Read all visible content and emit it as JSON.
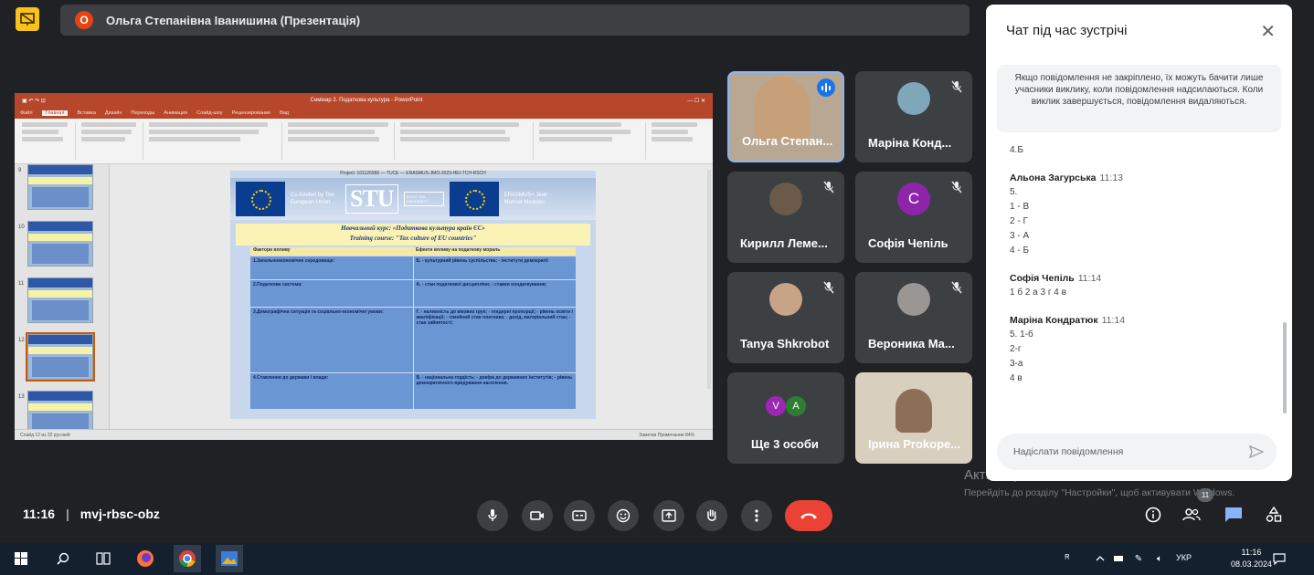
{
  "banner": {
    "avatar_letter": "О",
    "presenter": "Ольга Степанівна Іванишина (Презентація)"
  },
  "presentation": {
    "window_title": "Семінар 2. Податкова культура - PowerPoint",
    "menu": [
      "Файл",
      "Главная",
      "Вставка",
      "Дизайн",
      "Переходы",
      "Анимация",
      "Слайд-шоу",
      "Рецензирование",
      "Вид"
    ],
    "slide_numbers": [
      "9",
      "10",
      "11",
      "12",
      "13"
    ],
    "slide": {
      "header": "Project: 101126966 — TUCE — ERASMUS-JMO-2023-HEI-TCH-RSCH",
      "cofunded": "Co-funded by The European Union",
      "stu": "STU",
      "stu_sub": "STATE TAX UNIVERSITY",
      "jean_monnet": "ERASMUS+ Jean Monnet Modules",
      "course_ua": "Навчальний курс: «Податкова культура країн ЄС»",
      "course_en": "Training course: \"Tax culture of EU countries\"",
      "table_head": [
        "Фактори впливу",
        "Ефекти впливу на податкову мораль"
      ],
      "rows": [
        [
          "1.Загальноекономічне середовище:",
          "Б. - культурний рівень суспільства; - інститути демократії"
        ],
        [
          "2.Податкова система:",
          "А. - стан податкової дисципліни; - ставки оподаткування;"
        ],
        [
          "3.Демографічна ситуація та соціально-економічні умови:",
          "Г. - належність до вікових груп; - гендерні пропорції; - рівень освіти і кваліфікації; - сімейний стан платника; - дохід, матеріальний стан; - стан зайнятості;"
        ],
        [
          "4.Ставлення до держави і влади:",
          "В. - національна гордість; - довіра до державних інститутів; - рівень демократичного врядування населення."
        ]
      ]
    },
    "status_left": "Слайд 12 из 32   русский",
    "status_right": "Заметки   Примечания   84%"
  },
  "tiles": [
    {
      "name": "Ольга Степан...",
      "kind": "video-speaking"
    },
    {
      "name": "Маріна Конд...",
      "kind": "photo"
    },
    {
      "name": "Кирилл Леме...",
      "kind": "photo"
    },
    {
      "name": "Софія Чепіль",
      "kind": "letter",
      "letter": "С"
    },
    {
      "name": "Tanya Shkrobot",
      "kind": "photo"
    },
    {
      "name": "Вероника Ма...",
      "kind": "photo"
    },
    {
      "name": "Ще 3 особи",
      "kind": "more",
      "letters": [
        "V",
        "A"
      ]
    },
    {
      "name": "Ірина Prokope...",
      "kind": "video"
    }
  ],
  "chat": {
    "title": "Чат під час зустрічі",
    "note": "Якщо повідомлення не закріплено, їх можуть бачити лише учасники виклику, коли повідомлення надсилаються. Коли виклик завершується, повідомлення видаляються.",
    "first_line": "4.Б",
    "messages": [
      {
        "sender": "Альона Загурська",
        "time": "11:13",
        "lines": [
          "5.",
          "1 - В",
          "2 - Г",
          "3 - А",
          "4 - Б"
        ]
      },
      {
        "sender": "Софія Чепіль",
        "time": "11:14",
        "lines": [
          "1 б 2 а 3 г 4 в"
        ]
      },
      {
        "sender": "Маріна Кондратюк",
        "time": "11:14",
        "lines": [
          "5. 1-б",
          "2-г",
          "3-а",
          "4 в"
        ]
      }
    ],
    "input_placeholder": "Надіслати повідомлення"
  },
  "watermark": {
    "title": "Активація Windows",
    "sub": "Перейдіть до розділу \"Настройки\", щоб активувати Windows."
  },
  "bottom": {
    "time": "11:16",
    "meeting_code": "mvj-rbsc-obz",
    "participants_count": "11"
  },
  "taskbar": {
    "lang": "УКР",
    "time": "11:16",
    "date": "08.03.2024"
  },
  "colors": {
    "meet_bg": "#202124",
    "end_call": "#ea4335",
    "accent_blue": "#1a73e8",
    "ppt_red": "#b7472a"
  }
}
